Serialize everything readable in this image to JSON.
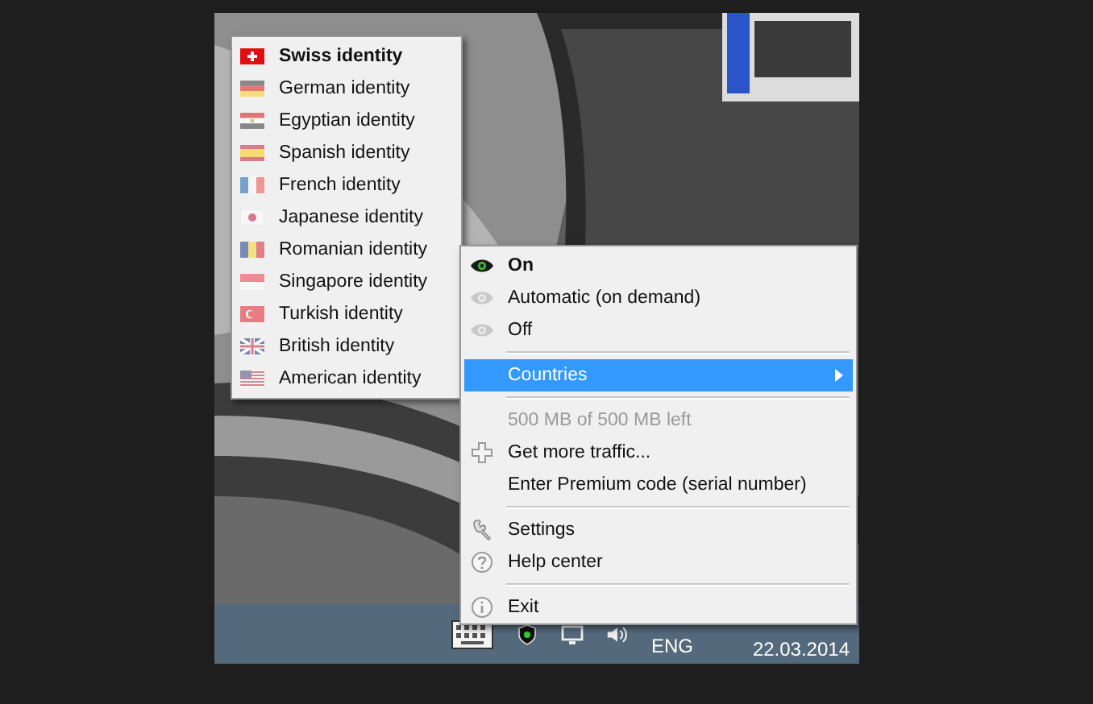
{
  "countries_menu": [
    {
      "label": "Swiss identity",
      "selected": true
    },
    {
      "label": "German identity",
      "selected": false
    },
    {
      "label": "Egyptian identity",
      "selected": false
    },
    {
      "label": "Spanish identity",
      "selected": false
    },
    {
      "label": "French identity",
      "selected": false
    },
    {
      "label": "Japanese identity",
      "selected": false
    },
    {
      "label": "Romanian identity",
      "selected": false
    },
    {
      "label": "Singapore identity",
      "selected": false
    },
    {
      "label": "Turkish identity",
      "selected": false
    },
    {
      "label": "British identity",
      "selected": false
    },
    {
      "label": "American identity",
      "selected": false
    }
  ],
  "context_menu": [
    {
      "kind": "radio",
      "label": "On",
      "selected": true
    },
    {
      "kind": "radio",
      "label": "Automatic (on demand)",
      "selected": false
    },
    {
      "kind": "radio",
      "label": "Off",
      "selected": false
    },
    {
      "kind": "separator"
    },
    {
      "kind": "submenu",
      "label": "Countries",
      "selected": true
    },
    {
      "kind": "separator"
    },
    {
      "kind": "status",
      "label": "500 MB of 500 MB left",
      "disabled": true
    },
    {
      "kind": "command",
      "label": "Get more traffic..."
    },
    {
      "kind": "command",
      "label": "Enter Premium code (serial number)"
    },
    {
      "kind": "separator"
    },
    {
      "kind": "command",
      "label": "Settings"
    },
    {
      "kind": "command",
      "label": "Help center"
    },
    {
      "kind": "separator"
    },
    {
      "kind": "command",
      "label": "Exit"
    }
  ],
  "taskbar": {
    "language": "ENG",
    "date": "22.03.2014"
  }
}
